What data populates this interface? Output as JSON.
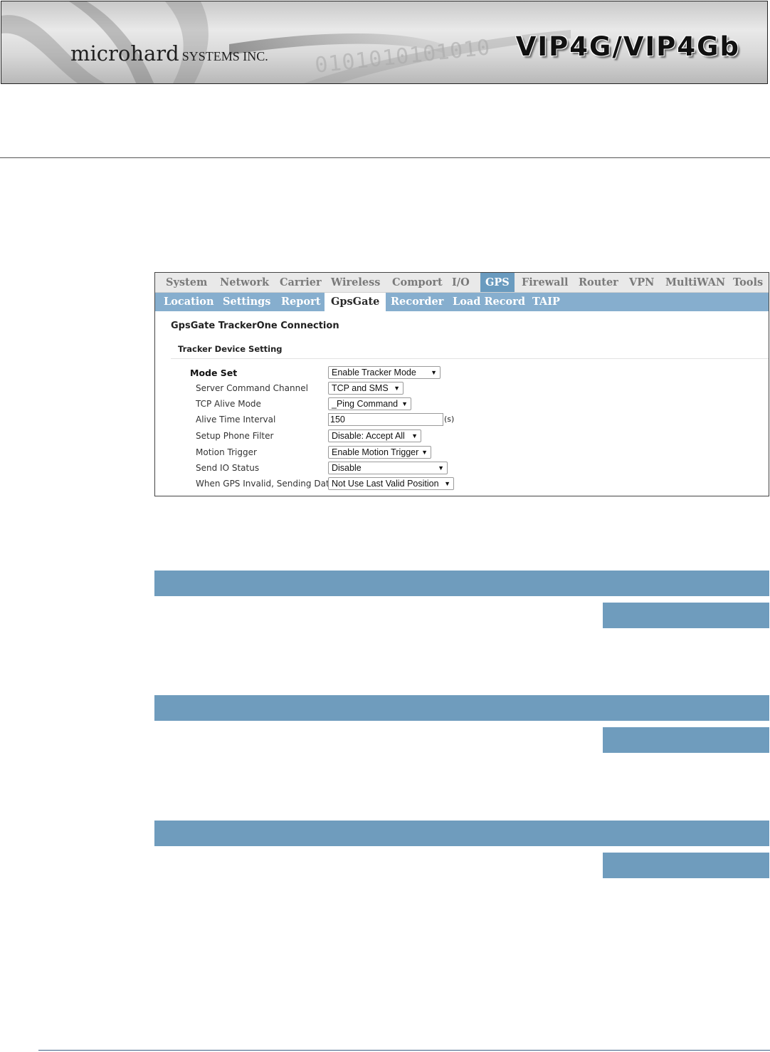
{
  "header": {
    "brand_name": "microhard",
    "brand_suffix": "SYSTEMS INC.",
    "product": "VIP4G/VIP4Gb",
    "binary_decoration": "0101010101010"
  },
  "ui": {
    "main_nav": [
      "System",
      "Network",
      "Carrier",
      "Wireless",
      "Comport",
      "I/O",
      "GPS",
      "Firewall",
      "Router",
      "VPN",
      "MultiWAN",
      "Tools"
    ],
    "main_nav_active": "GPS",
    "sub_nav": [
      "Location",
      "Settings",
      "Report",
      "GpsGate",
      "Recorder",
      "Load Record",
      "TAIP"
    ],
    "sub_nav_active": "GpsGate",
    "section_title": "GpsGate TrackerOne Connection",
    "subsection_title": "Tracker Device Setting",
    "fields": {
      "mode_set": {
        "label": "Mode Set",
        "value": "Enable Tracker Mode"
      },
      "server_command_channel": {
        "label": "Server Command Channel",
        "value": "TCP and SMS"
      },
      "tcp_alive_mode": {
        "label": "TCP Alive Mode",
        "value": "_Ping Command"
      },
      "alive_time_interval": {
        "label": "Alive Time Interval",
        "value": "150",
        "unit": "(s)"
      },
      "setup_phone_filter": {
        "label": "Setup Phone Filter",
        "value": "Disable: Accept All"
      },
      "motion_trigger": {
        "label": "Motion Trigger",
        "value": "Enable Motion Trigger"
      },
      "send_io_status": {
        "label": "Send IO Status",
        "value": "Disable"
      },
      "gps_invalid_sending_data": {
        "label": "When GPS Invalid, Sending Data",
        "value": "Not Use Last Valid Position"
      }
    }
  },
  "colors": {
    "bar": "#6f9cbd",
    "sub_nav_bg": "#86aece",
    "active_tab": "#6a9bbf",
    "page_rule": "#555555",
    "footer_rule": "#3d5f85"
  }
}
